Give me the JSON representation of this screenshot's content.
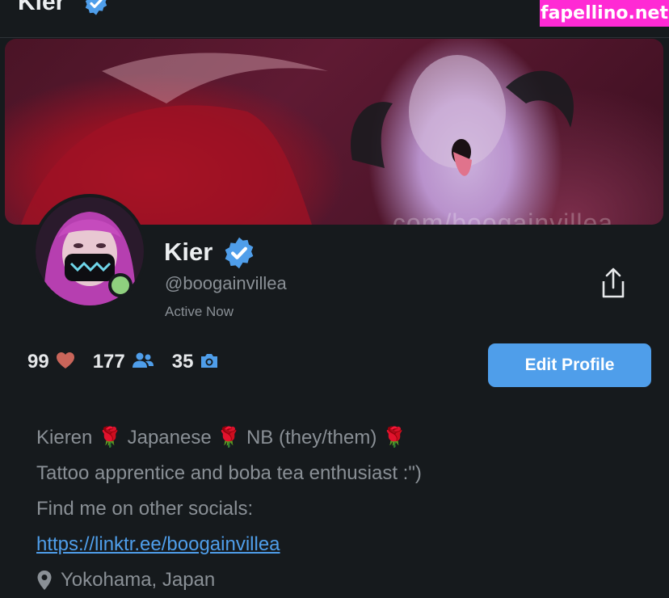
{
  "header": {
    "title": "Kier",
    "verified_icon": "verified-badge-icon"
  },
  "watermark": {
    "text": "fapellino.net",
    "bg_color": "#ff2ad4"
  },
  "banner": {
    "overlay_text": ".com/boogainvillea"
  },
  "profile": {
    "name": "Kier",
    "handle": "@boogainvillea",
    "status": "Active Now",
    "online_color": "#8fd07f",
    "share_icon": "share-icon"
  },
  "stats": [
    {
      "value": "99",
      "icon": "heart-icon",
      "color": "#c9655a"
    },
    {
      "value": "177",
      "icon": "fans-icon",
      "color": "#4f9eea"
    },
    {
      "value": "35",
      "icon": "camera-icon",
      "color": "#4f9eea"
    }
  ],
  "edit_profile": {
    "label": "Edit Profile",
    "color": "#4f9eea"
  },
  "bio": {
    "line1": {
      "parts": [
        "Kieren",
        "Japanese",
        "NB (they/them)"
      ],
      "separator": "🌹"
    },
    "line2": "Tattoo apprentice and boba tea enthusiast :\")",
    "line3": "Find me on other socials:",
    "link": "https://linktr.ee/boogainvillea",
    "location": "Yokohama, Japan",
    "location_icon": "location-pin-icon"
  }
}
